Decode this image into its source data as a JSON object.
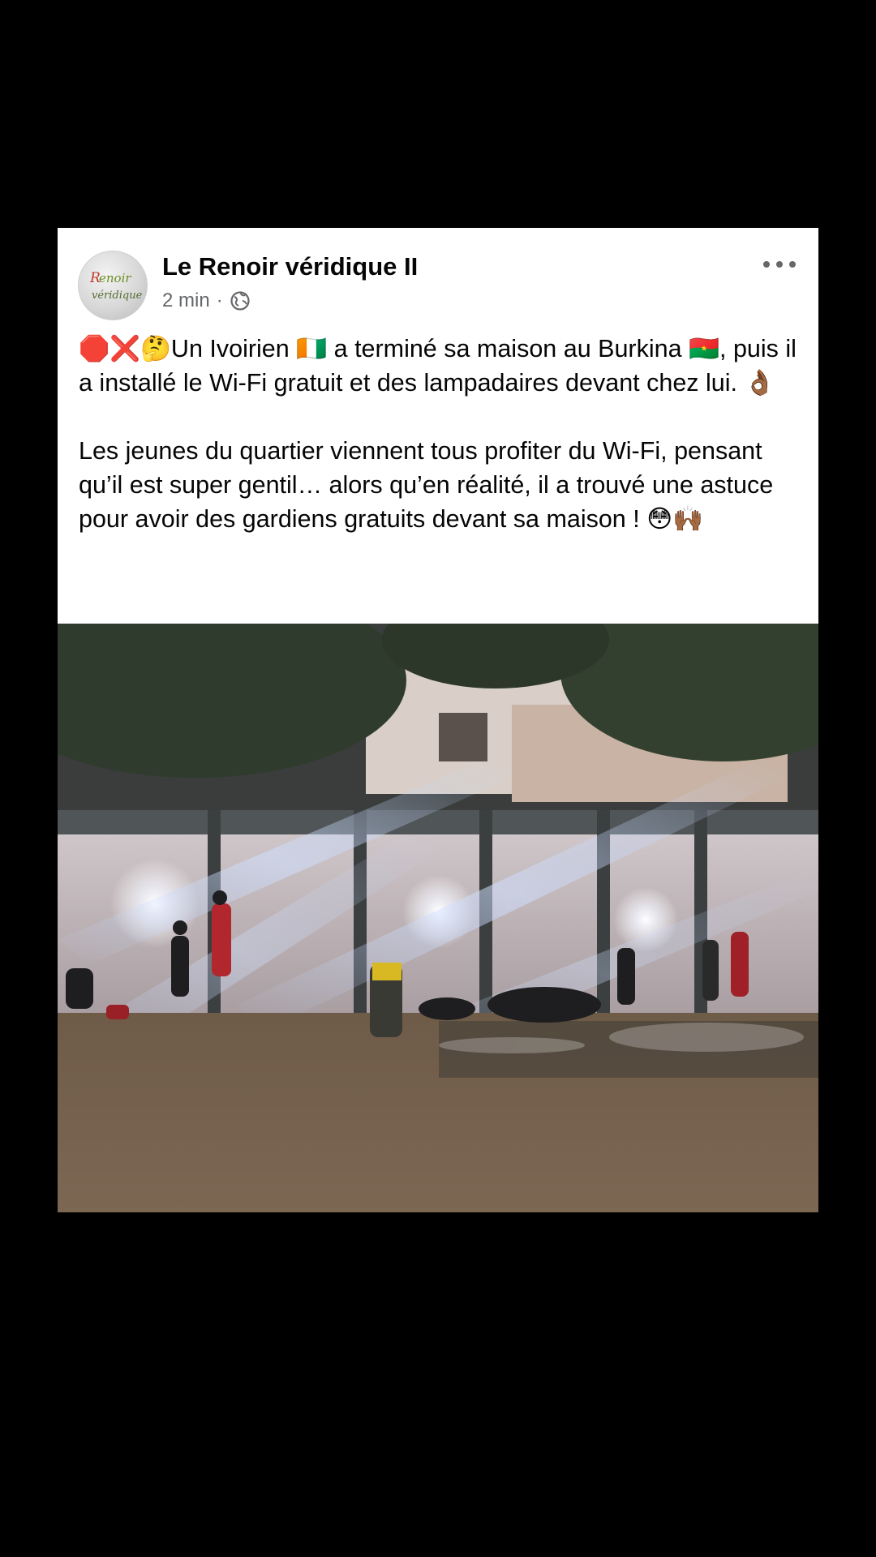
{
  "post": {
    "author": "Le Renoir véridique II",
    "time": "2 min",
    "separator": "·",
    "audience_icon": "globe-icon",
    "more_icon": "more-horizontal-icon",
    "avatar_text_line1": "Renoir",
    "avatar_text_line2": "véridique",
    "paragraph1": "🛑❌🤔Un Ivoirien 🇨🇮 a terminé sa maison au Burkina 🇧🇫, puis il a installé le Wi-Fi gratuit et des lampadaires devant chez lui. 👌🏾",
    "paragraph2": "Les jeunes du quartier viennent tous profiter du Wi-Fi, pensant qu’il est super gentil… alors qu’en réalité, il a trouvé une astuce pour avoir des gardiens gratuits devant sa maison ! 😳🙌🏾"
  },
  "colors": {
    "background": "#000000",
    "card": "#ffffff",
    "text_primary": "#050505",
    "text_secondary": "#65676b"
  }
}
